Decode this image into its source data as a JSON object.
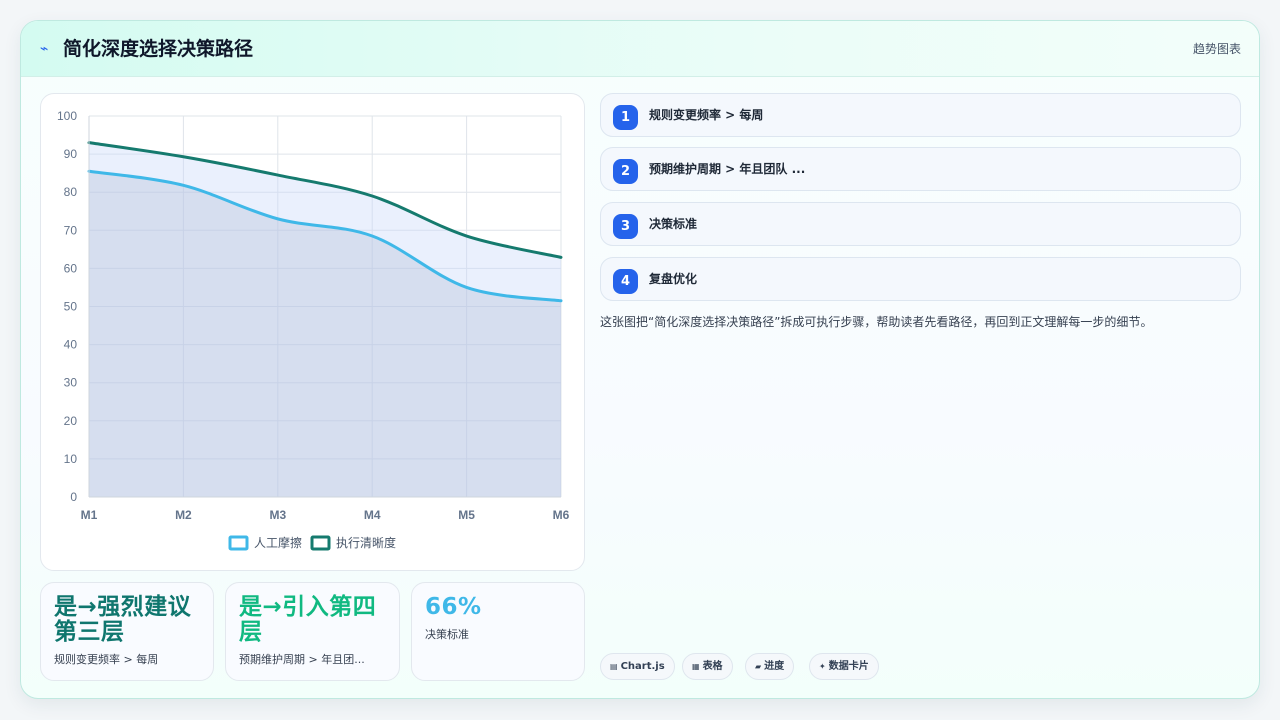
{
  "header": {
    "icon": "sparkle-line-icon",
    "title": "简化深度选择决策路径",
    "badge": "趋势图表"
  },
  "chart_data": {
    "type": "line",
    "x": [
      "M1",
      "M2",
      "M3",
      "M4",
      "M5",
      "M6"
    ],
    "series": [
      {
        "name": "人工摩擦",
        "values": [
          85.5,
          81.8,
          73.0,
          68.5,
          55.0,
          51.5
        ],
        "color": "#3fb8e8",
        "fill": true
      },
      {
        "name": "执行清晰度",
        "values": [
          93.0,
          89.3,
          84.5,
          79.0,
          68.5,
          62.9
        ],
        "color": "#157a6e",
        "fill": true
      }
    ],
    "ylim": [
      0,
      100
    ],
    "yticks": [
      0,
      10,
      20,
      30,
      40,
      50,
      60,
      70,
      80,
      90,
      100
    ],
    "grid": true,
    "legend": "bottom"
  },
  "stats": [
    {
      "value": "是→强烈建议第三层",
      "label": "规则变更频率 > 每周",
      "color": "#0f766e"
    },
    {
      "value": "是→引入第四层",
      "label": "预期维护周期 > 年且团...",
      "color": "#10b981"
    },
    {
      "value": "66%",
      "label": "决策标准",
      "color": "#3fb8e8"
    }
  ],
  "steps": [
    {
      "num": "1",
      "text": "规则变更频率 > 每周"
    },
    {
      "num": "2",
      "text": "预期维护周期 > 年且团队 ..."
    },
    {
      "num": "3",
      "text": "决策标准"
    },
    {
      "num": "4",
      "text": "复盘优化"
    }
  ],
  "description": "这张图把“简化深度选择决策路径”拆成可执行步骤，帮助读者先看路径，再回到正文理解每一步的细节。",
  "tags": [
    {
      "icon": "▤",
      "label": "Chart.js"
    },
    {
      "icon": "▦",
      "label": "表格"
    },
    {
      "icon": "▰",
      "label": "进度"
    },
    {
      "icon": "✦",
      "label": "数据卡片"
    }
  ]
}
